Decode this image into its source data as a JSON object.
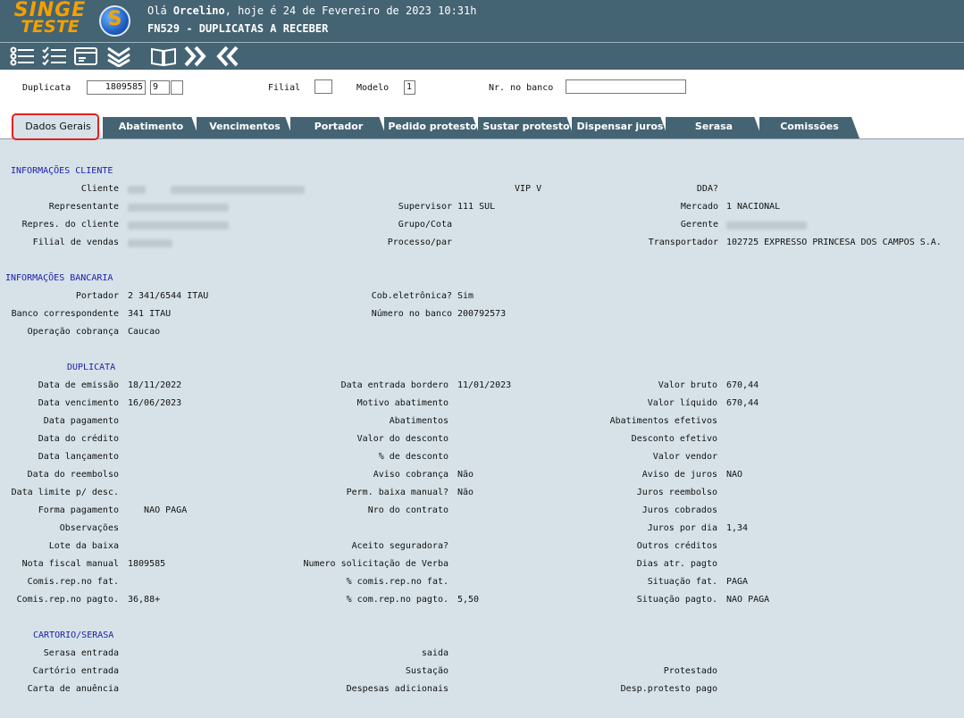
{
  "header": {
    "logo_line1": "SINGE",
    "logo_line2": "TESTE",
    "greeting_prefix": "Olá ",
    "user": "Orcelino",
    "greeting_suffix": ", hoje é 24 de Fevereiro de 2023 10:31h",
    "module": "FN529 - DUPLICATAS A RECEBER"
  },
  "toolbar": {
    "icons": [
      "list-icon",
      "checklist-icon",
      "card-icon",
      "chevrons-down-icon",
      "book-icon",
      "forward-icon",
      "back-icon"
    ]
  },
  "filters": {
    "duplicata_label": "Duplicata",
    "duplicata_value": "1809585",
    "duplicata_seq": "9",
    "duplicata_extra": "",
    "filial_label": "Filial",
    "filial_value": "",
    "modelo_label": "Modelo",
    "modelo_value": "1",
    "nr_banco_label": "Nr. no banco",
    "nr_banco_value": ""
  },
  "tabs": [
    "Dados Gerais",
    "Abatimento",
    "Vencimentos",
    "Portador",
    "Pedido protesto",
    "Sustar protesto",
    "Dispensar juros",
    "Serasa",
    "Comissões"
  ],
  "cliente": {
    "section": "INFORMAÇÕES CLIENTE",
    "cliente_label": "Cliente",
    "vip": "VIP V",
    "dda_label": "DDA?",
    "representante_label": "Representante",
    "supervisor_label": "Supervisor",
    "supervisor_value": "111  SUL",
    "mercado_label": "Mercado",
    "mercado_value": "1    NACIONAL",
    "repres_cliente_label": "Repres. do cliente",
    "grupo_label": "Grupo/Cota",
    "gerente_label": "Gerente",
    "filial_vendas_label": "Filial de vendas",
    "processo_label": "Processo/par",
    "transportador_label": "Transportador",
    "transportador_value": "102725  EXPRESSO PRINCESA DOS CAMPOS S.A."
  },
  "bancaria": {
    "section": "INFORMAÇÕES BANCARIA",
    "portador_label": "Portador",
    "portador_value": "2 341/6544 ITAU",
    "cob_label": "Cob.eletrônica?",
    "cob_value": "Sim",
    "banco_corr_label": "Banco correspondente",
    "banco_corr_value": "341  ITAU",
    "numero_banco_label": "Número no banco",
    "numero_banco_value": "200792573",
    "operacao_label": "Operação cobrança",
    "operacao_value": "Caucao"
  },
  "duplicata": {
    "section": "DUPLICATA",
    "rows": [
      {
        "l1": "Data de emissão",
        "v1": "18/11/2022",
        "l2": "Data entrada bordero",
        "v2": "11/01/2023",
        "l3": "Valor bruto",
        "v3": "670,44"
      },
      {
        "l1": "Data vencimento",
        "v1": "16/06/2023",
        "l2": "Motivo abatimento",
        "v2": "",
        "l3": "Valor líquido",
        "v3": "670,44"
      },
      {
        "l1": "Data pagamento",
        "v1": "",
        "l2": "Abatimentos",
        "v2": "",
        "l3": "Abatimentos efetivos",
        "v3": ""
      },
      {
        "l1": "Data do crédito",
        "v1": "",
        "l2": "Valor do desconto",
        "v2": "",
        "l3": "Desconto efetivo",
        "v3": ""
      },
      {
        "l1": "Data lançamento",
        "v1": "",
        "l2": "% de desconto",
        "v2": "",
        "l3": "Valor vendor",
        "v3": ""
      },
      {
        "l1": "Data do reembolso",
        "v1": "",
        "l2": "Aviso cobrança",
        "v2": "Não",
        "l3": "Aviso de juros",
        "v3": "NAO"
      },
      {
        "l1": "Data limite p/ desc.",
        "v1": "",
        "l2": "Perm. baixa manual?",
        "v2": "Não",
        "l3": "Juros reembolso",
        "v3": ""
      },
      {
        "l1": "Forma pagamento",
        "v1": "   NAO PAGA",
        "l2": "Nro do contrato",
        "v2": "",
        "l3": "Juros cobrados",
        "v3": ""
      },
      {
        "l1": "Observações",
        "v1": "",
        "l2": "",
        "v2": "",
        "l3": "Juros por dia",
        "v3": "1,34"
      },
      {
        "l1": "Lote da baixa",
        "v1": "",
        "l2": "Aceito seguradora?",
        "v2": "",
        "l3": "Outros créditos",
        "v3": ""
      },
      {
        "l1": "Nota fiscal manual",
        "v1": "1809585",
        "l2": "Numero solicitação de Verba",
        "v2": "",
        "l3": "Dias atr. pagto",
        "v3": ""
      },
      {
        "l1": "Comis.rep.no fat.",
        "v1": "",
        "l2": "% comis.rep.no fat.",
        "v2": "",
        "l3": "Situação fat.",
        "v3": "PAGA"
      },
      {
        "l1": "Comis.rep.no pagto.",
        "v1": "36,88+",
        "l2": "% com.rep.no pagto.",
        "v2": "5,50",
        "l3": "Situação pagto.",
        "v3": "NAO PAGA"
      }
    ]
  },
  "cartorio": {
    "section": "CARTORIO/SERASA",
    "serasa_entrada_label": "Serasa entrada",
    "saida_label": "saida",
    "cartorio_entrada_label": "Cartório entrada",
    "sustacao_label": "Sustação",
    "protestado_label": "Protestado",
    "carta_label": "Carta de anuência",
    "despesas_label": "Despesas adicionais",
    "desp_protesto_label": "Desp.protesto pago"
  },
  "colors": {
    "header_bg": "#446373",
    "panel_bg": "#d6e2e8",
    "section_title": "#1b1ea8",
    "logo": "#f2a000",
    "active_outline": "#e41f1f"
  }
}
